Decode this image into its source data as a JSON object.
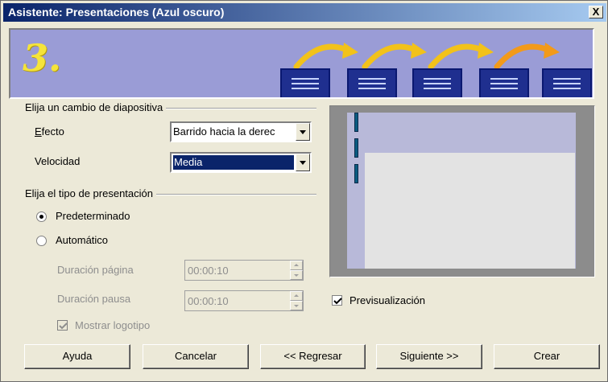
{
  "window": {
    "title": "Asistente: Presentaciones (Azul oscuro)",
    "close_label": "X"
  },
  "banner": {
    "step_number": "3."
  },
  "transition_group": {
    "title": "Elija un cambio de diapositiva",
    "effect_label": "Efecto",
    "effect_value": "Barrido hacia la derec",
    "speed_label": "Velocidad",
    "speed_value": "Media"
  },
  "type_group": {
    "title": "Elija el tipo de presentación",
    "default_label": "Predeterminado",
    "automatic_label": "Automático",
    "selected": "default",
    "page_duration_label": "Duración página",
    "page_duration_value": "00:00:10",
    "pause_duration_label": "Duración pausa",
    "pause_duration_value": "00:00:10",
    "show_logo_label": "Mostrar logotipo",
    "show_logo_checked": true
  },
  "preview": {
    "checkbox_label": "Previsualización",
    "checked": true
  },
  "buttons": {
    "help": "Ayuda",
    "cancel": "Cancelar",
    "back": "<< Regresar",
    "next": "Siguiente >>",
    "create": "Crear"
  },
  "colors": {
    "title_start": "#0a246a",
    "title_end": "#a6caf0",
    "banner": "#9a9cd6",
    "selection": "#0a246a"
  }
}
